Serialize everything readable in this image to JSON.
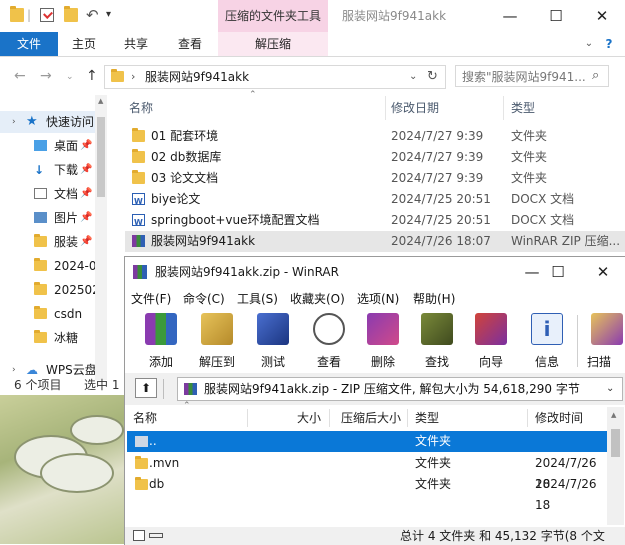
{
  "explorer": {
    "contextual_tab_title": "压缩的文件夹工具",
    "window_title": "服装网站9f941akk",
    "ribbon_tabs": [
      "文件",
      "主页",
      "共享",
      "查看"
    ],
    "contextual_tab": "解压缩",
    "address_path": "服装网站9f941akk",
    "search_placeholder": "搜索\"服装网站9f941...",
    "nav_items": [
      {
        "label": "快速访问",
        "icon": "star-icon"
      },
      {
        "label": "桌面",
        "icon": "desktop-icon"
      },
      {
        "label": "下载",
        "icon": "download-icon"
      },
      {
        "label": "文档",
        "icon": "document-icon"
      },
      {
        "label": "图片",
        "icon": "picture-icon"
      },
      {
        "label": "服装",
        "icon": "folder-icon"
      },
      {
        "label": "2024-0",
        "icon": "folder-icon"
      },
      {
        "label": "202502",
        "icon": "folder-icon"
      },
      {
        "label": "csdn",
        "icon": "folder-icon"
      },
      {
        "label": "冰糖",
        "icon": "folder-icon"
      },
      {
        "label": "WPS云盘",
        "icon": "cloud-icon"
      }
    ],
    "columns": {
      "name": "名称",
      "date": "修改日期",
      "type": "类型"
    },
    "files": [
      {
        "name": "01 配套环境",
        "date": "2024/7/27 9:39",
        "type": "文件夹",
        "icon": "folder-icon"
      },
      {
        "name": "02 db数据库",
        "date": "2024/7/27 9:39",
        "type": "文件夹",
        "icon": "folder-icon"
      },
      {
        "name": "03 论文文档",
        "date": "2024/7/27 9:39",
        "type": "文件夹",
        "icon": "folder-icon"
      },
      {
        "name": "biye论文",
        "date": "2024/7/25 20:51",
        "type": "DOCX 文档",
        "icon": "docx-icon"
      },
      {
        "name": "springboot+vue环境配置文档",
        "date": "2024/7/25 20:51",
        "type": "DOCX 文档",
        "icon": "docx-icon"
      },
      {
        "name": "服装网站9f941akk",
        "date": "2024/7/26 18:07",
        "type": "WinRAR ZIP 压缩...",
        "icon": "winrar-icon"
      }
    ],
    "status_count": "6 个项目",
    "status_selected": "选中 1"
  },
  "winrar": {
    "title": "服装网站9f941akk.zip - WinRAR",
    "menu": [
      "文件(F)",
      "命令(C)",
      "工具(S)",
      "收藏夹(O)",
      "选项(N)",
      "帮助(H)"
    ],
    "toolbar": [
      "添加",
      "解压到",
      "测试",
      "查看",
      "删除",
      "查找",
      "向导",
      "信息",
      "扫描"
    ],
    "path_text": "服装网站9f941akk.zip - ZIP 压缩文件, 解包大小为 54,618,290 字节",
    "columns": {
      "name": "名称",
      "size": "大小",
      "packed": "压缩后大小",
      "type": "类型",
      "modified": "修改时间"
    },
    "rows": [
      {
        "name": "..",
        "type": "文件夹",
        "modified": ""
      },
      {
        "name": ".mvn",
        "type": "文件夹",
        "modified": "2024/7/26 18"
      },
      {
        "name": "db",
        "type": "文件夹",
        "modified": "2024/7/26 18"
      }
    ],
    "status_text": "总计 4 文件夹 和 45,132 字节(8 个文"
  },
  "colors": {
    "accent": "#1a73c8",
    "selection": "#0a78d7",
    "context_tab": "#f7d3e5",
    "folder": "#f0c24a"
  }
}
